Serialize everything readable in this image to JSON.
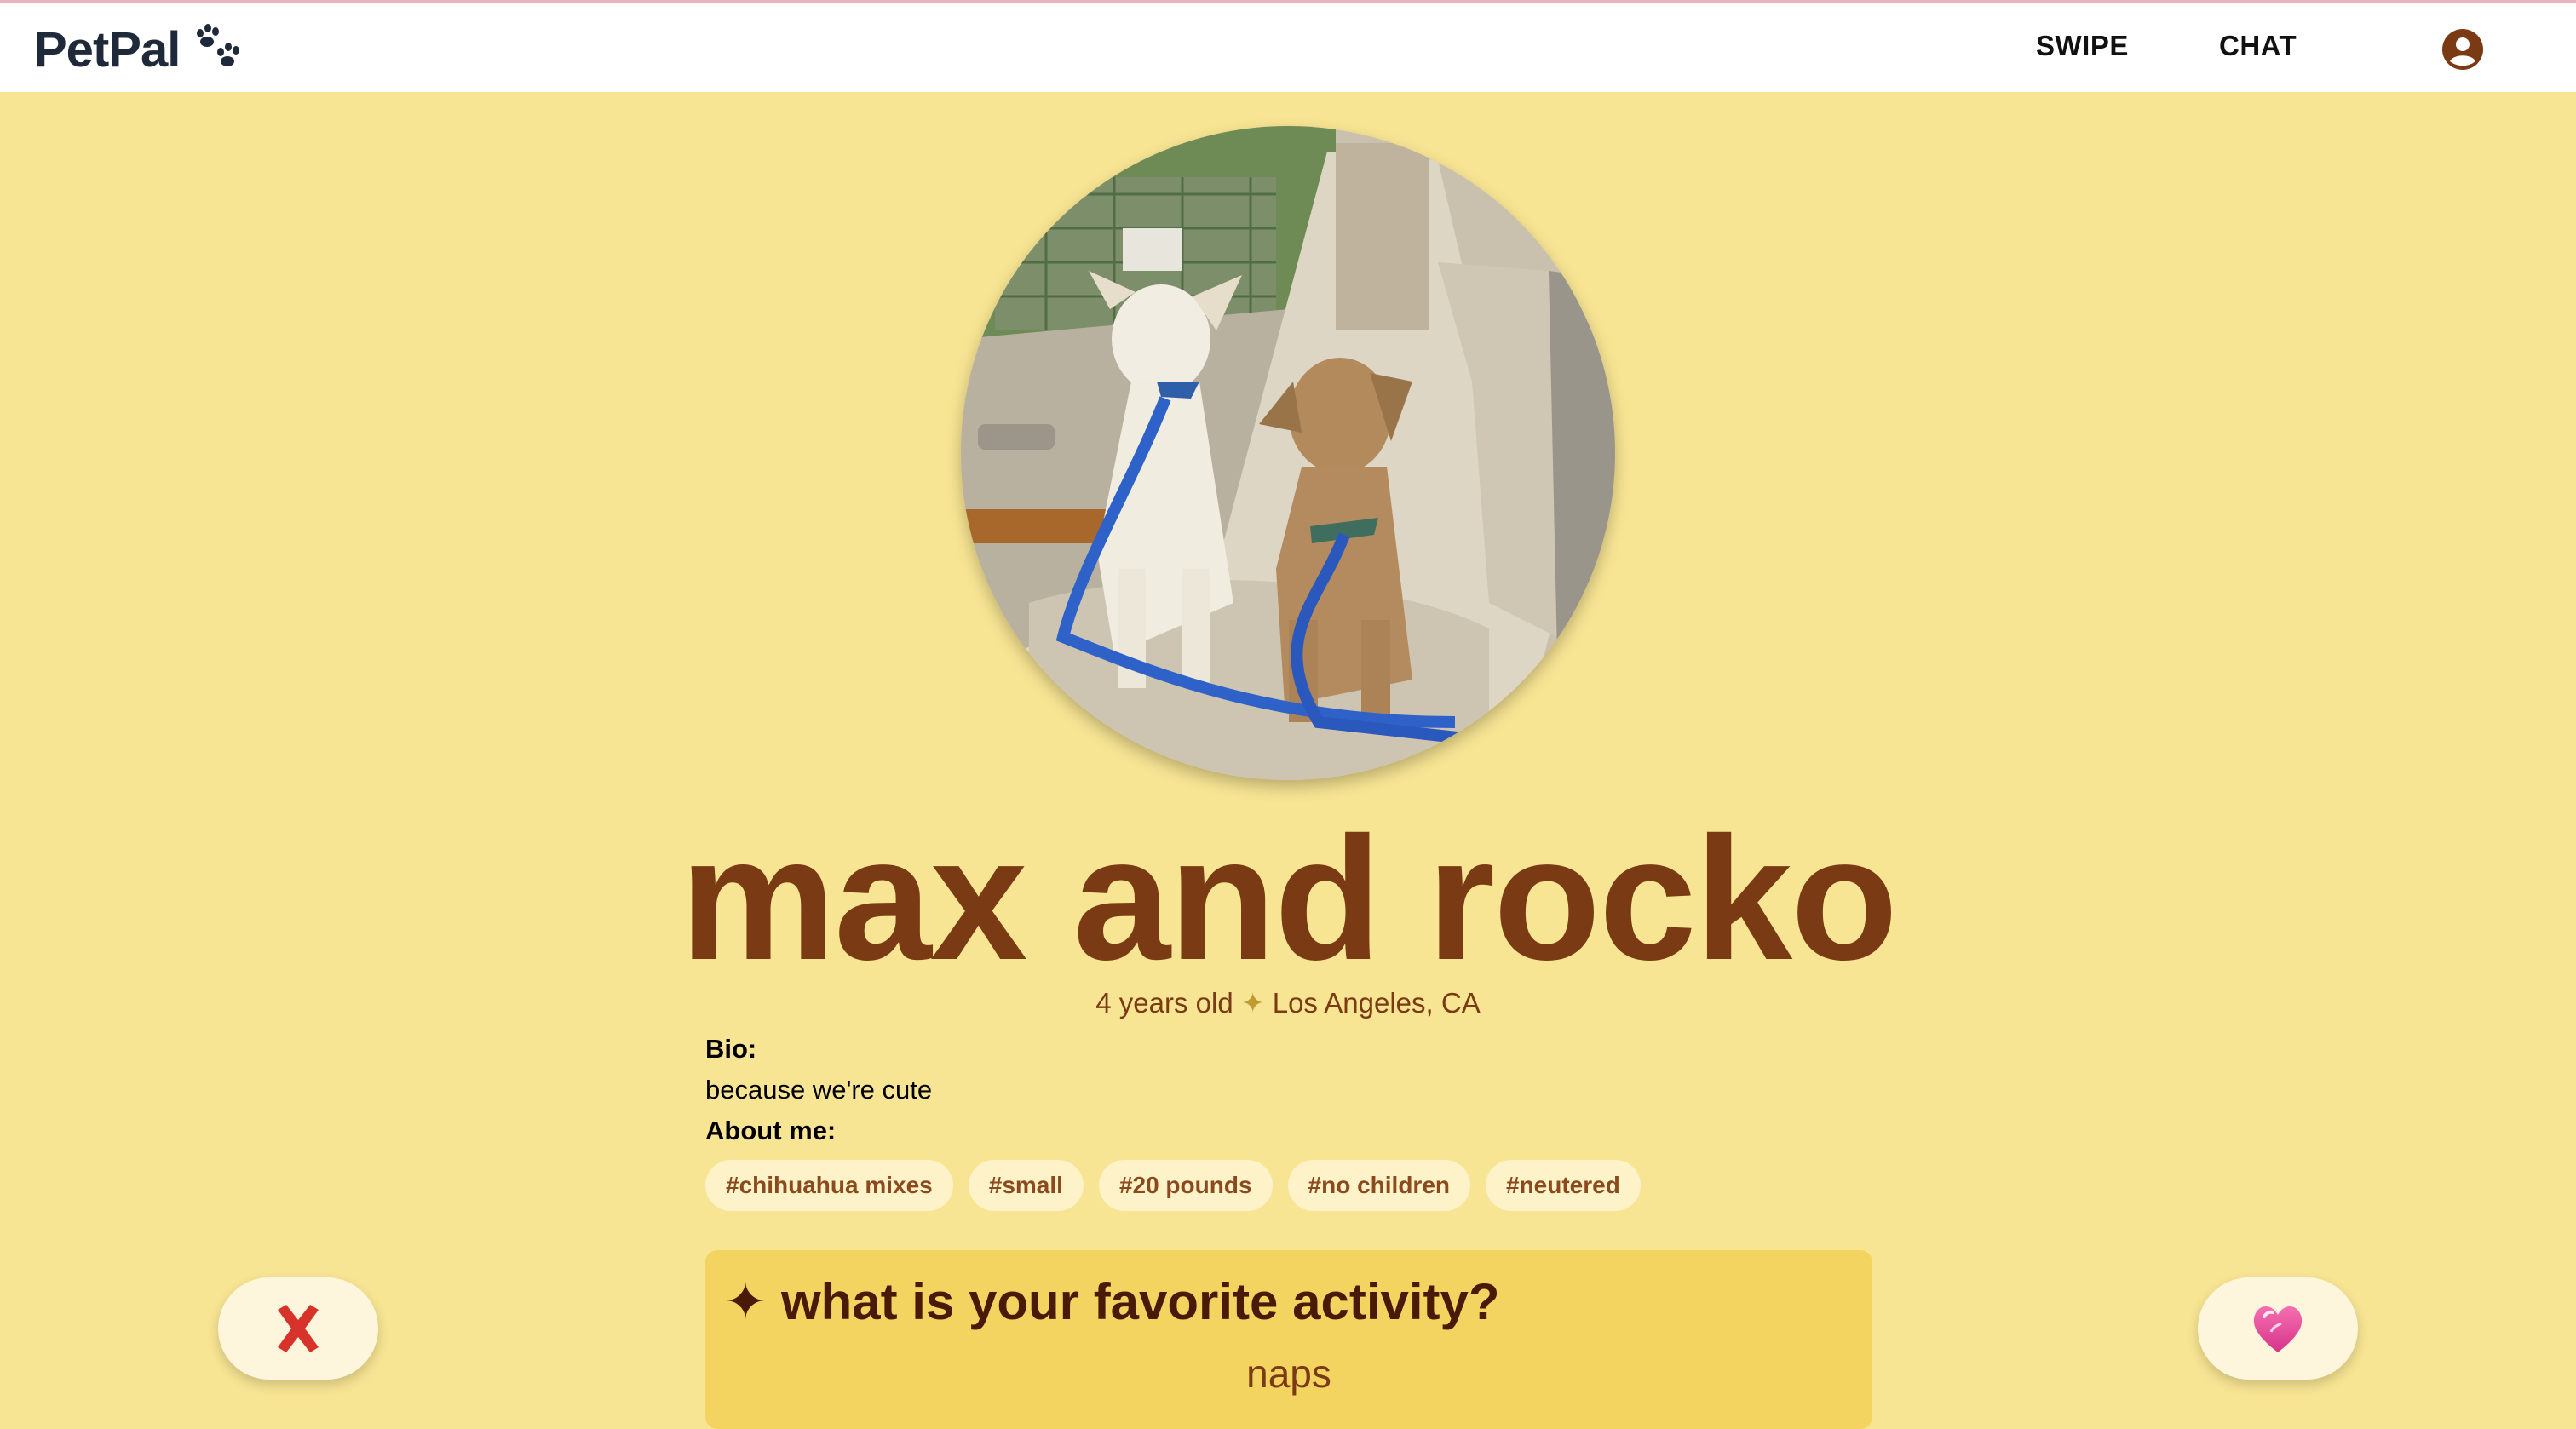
{
  "header": {
    "logo_text": "PetPal",
    "nav": [
      {
        "label": "SWIPE"
      },
      {
        "label": "CHAT"
      }
    ],
    "icons": {
      "logo": "paw-prints-icon",
      "account": "account-circle-icon"
    }
  },
  "profile": {
    "name": "max and rocko",
    "age": "4 years old",
    "separator": "✦",
    "location": "Los Angeles, CA",
    "bio_label": "Bio:",
    "bio": "because we're cute",
    "about_label": "About me:",
    "tags": [
      "#chihuahua mixes",
      "#small",
      "#20 pounds",
      "#no children",
      "#neutered"
    ]
  },
  "prompt": {
    "icon": "✦",
    "question": "what is your favorite activity?",
    "answer": "naps"
  },
  "actions": {
    "reject_icon": "red-x-icon",
    "like_icon": "pink-heart-icon"
  },
  "colors": {
    "background": "#f8e593",
    "accent_brown": "#7a3a14",
    "card": "#f4d460",
    "tag_bg": "#fdf2c8"
  }
}
